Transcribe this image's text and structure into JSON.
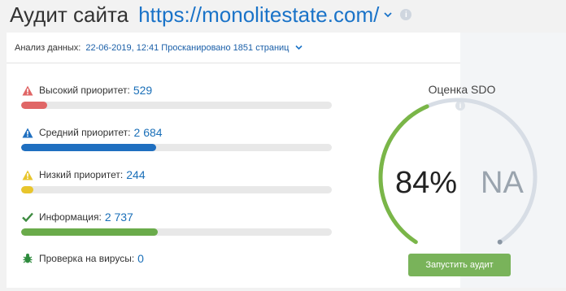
{
  "header": {
    "title": "Аудит сайта",
    "url": "https://monolitestate.com/"
  },
  "analysis": {
    "label": "Анализ данных:",
    "value": "22-06-2019, 12:41 Просканировано 1851 страниц"
  },
  "metrics": [
    {
      "label": "Высокий приоритет:",
      "value": "529",
      "icon": "warning-icon",
      "color": "#e06666",
      "fill_fraction": 0.085
    },
    {
      "label": "Средний приоритет:",
      "value": "2 684",
      "icon": "warning-icon",
      "color": "#1f6fc0",
      "fill_fraction": 0.435
    },
    {
      "label": "Низкий приоритет:",
      "value": "244",
      "icon": "warning-icon",
      "color": "#e8c52c",
      "fill_fraction": 0.04
    },
    {
      "label": "Информация:",
      "value": "2 737",
      "icon": "checkmark-icon",
      "color": "#6aab4a",
      "fill_fraction": 0.44
    },
    {
      "label": "Проверка на вирусы:",
      "value": "0",
      "icon": "bug-icon",
      "color": "#2e8b3d"
    }
  ],
  "gauge": {
    "title": "Оценка SDO",
    "score": "84%",
    "score_fraction": 0.84,
    "na": "NA",
    "accent": "#7ab648",
    "track": "#d7dde5"
  },
  "actions": {
    "start_audit": "Запустить аудит"
  }
}
